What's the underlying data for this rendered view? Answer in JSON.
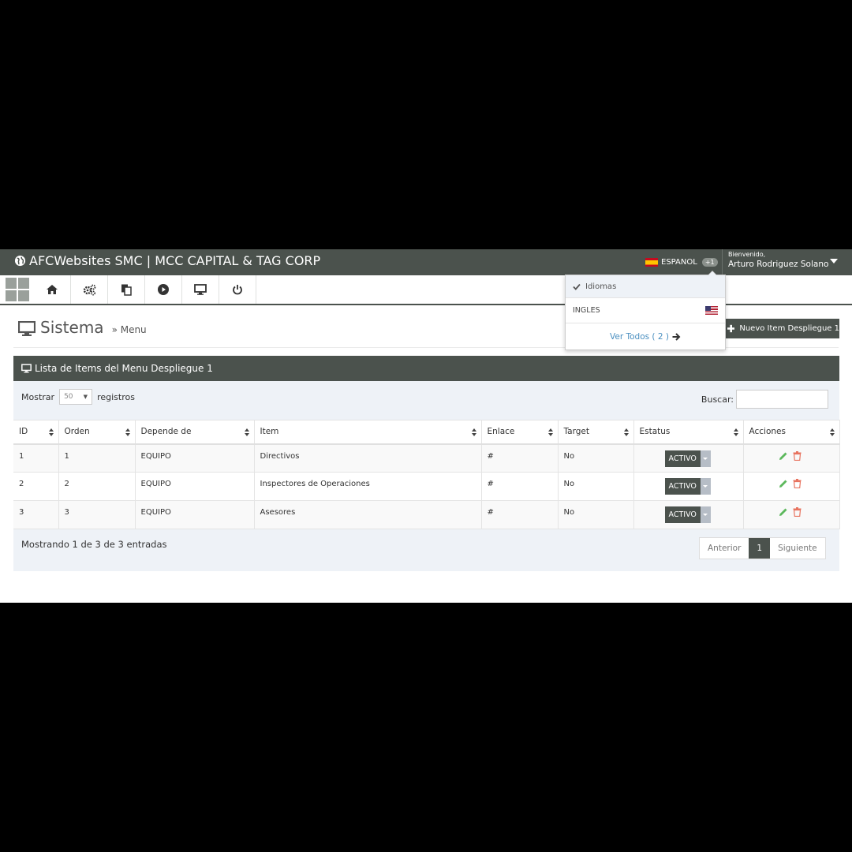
{
  "navbar": {
    "brand": "AFCWebsites SMC | MCC CAPITAL & TAG CORP",
    "language": "ESPANOL",
    "language_badge": "+1",
    "user_greeting": "Bienvenido,",
    "user_name": "Arturo Rodriguez Solano"
  },
  "toolbar": {
    "icons": [
      "home-icon",
      "cogs-icon",
      "files-icon",
      "play-icon",
      "monitor-icon",
      "power-icon"
    ]
  },
  "page": {
    "title": "Sistema",
    "subtitle": "» Menu",
    "new_button": "Nuevo Item Despliegue 1"
  },
  "panel": {
    "title": "Lista de Items del Menu Despliegue 1",
    "show_label": "Mostrar",
    "page_length": "50",
    "records_label": "registros",
    "search_label": "Buscar:",
    "search_value": ""
  },
  "table": {
    "headers": [
      "ID",
      "Orden",
      "Depende de",
      "Item",
      "Enlace",
      "Target",
      "Estatus",
      "Acciones"
    ],
    "rows": [
      {
        "id": "1",
        "orden": "1",
        "depende": "EQUIPO",
        "item": "Directivos",
        "enlace": "#",
        "target": "No",
        "estatus": "ACTIVO"
      },
      {
        "id": "2",
        "orden": "2",
        "depende": "EQUIPO",
        "item": "Inspectores de Operaciones",
        "enlace": "#",
        "target": "No",
        "estatus": "ACTIVO"
      },
      {
        "id": "3",
        "orden": "3",
        "depende": "EQUIPO",
        "item": "Asesores",
        "enlace": "#",
        "target": "No",
        "estatus": "ACTIVO"
      }
    ]
  },
  "footer": {
    "info": "Mostrando 1 de 3 de 3 entradas",
    "prev": "Anterior",
    "current_page": "1",
    "next": "Siguiente"
  },
  "language_dropdown": {
    "header": "Idiomas",
    "items": [
      {
        "label": "INGLES",
        "flag": "us-flag-icon"
      }
    ],
    "view_all": "Ver Todos ( 2 )"
  },
  "colors": {
    "primary": "#4b524d",
    "panel_bg": "#eef2f7",
    "link": "#4a8fc0",
    "edit": "#5cb85c",
    "delete": "#e8735f"
  }
}
